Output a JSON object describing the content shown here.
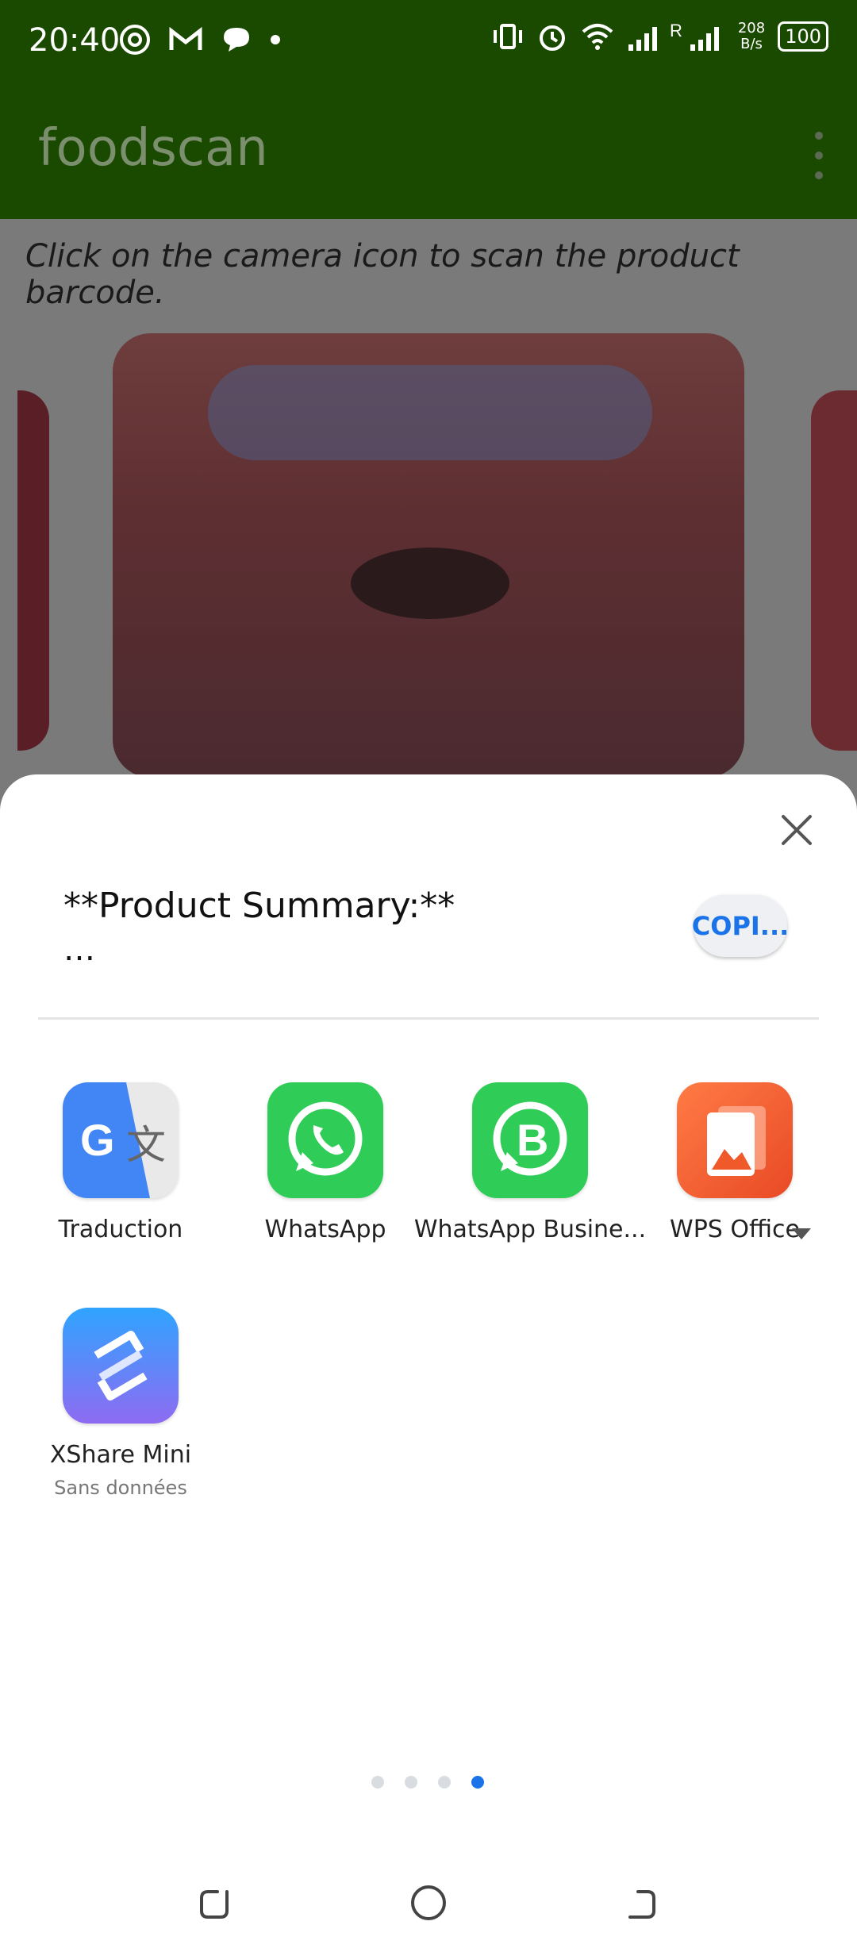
{
  "status_bar": {
    "time": "20:40",
    "net_speed_value": "208",
    "net_speed_unit": "B/s",
    "battery": "100",
    "roaming_label": "R",
    "left_icons": [
      "chrome-icon",
      "gmail-icon",
      "chat-bubble-icon",
      "dot-icon"
    ],
    "right_icons": [
      "vibrate-icon",
      "alarm-icon",
      "wifi-icon",
      "signal-icon",
      "signal-roaming-icon"
    ]
  },
  "app_bar": {
    "title": "foodscan"
  },
  "content": {
    "instruction": "Click on the camera icon to scan the product barcode."
  },
  "share_sheet": {
    "preview_text": "**Product Summary:**",
    "preview_ellipsis": "…",
    "copy_label": "COPI...",
    "targets": [
      {
        "label": "Traduction",
        "icon": "google-translate-icon"
      },
      {
        "label": "WhatsApp",
        "icon": "whatsapp-icon"
      },
      {
        "label": "WhatsApp Busine...",
        "icon": "whatsapp-business-icon"
      },
      {
        "label": "WPS Office",
        "icon": "wps-office-icon"
      },
      {
        "label": "XShare Mini",
        "sublabel": "Sans données",
        "icon": "xshare-icon"
      }
    ],
    "page_count": 4,
    "active_page": 4
  },
  "colors": {
    "app_bar": "#1a4a00",
    "accent": "#1a73e8",
    "whatsapp": "#2fcc57",
    "wps": "#f05a2b"
  }
}
